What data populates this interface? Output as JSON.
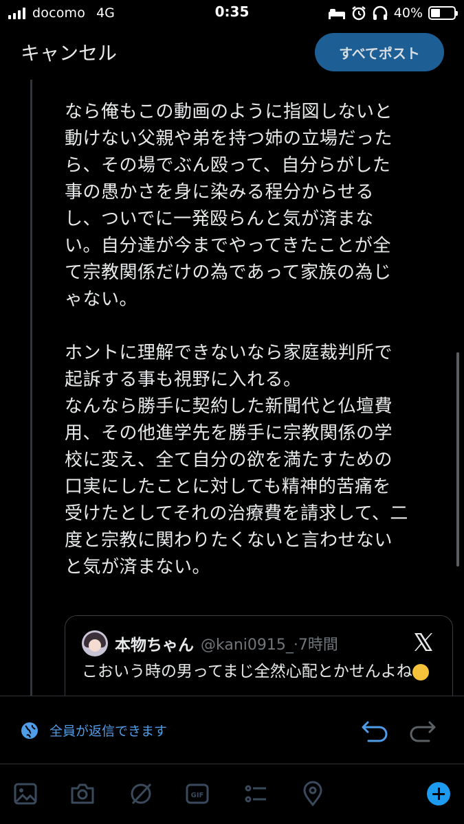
{
  "status": {
    "carrier": "docomo",
    "network": "4G",
    "time": "0:35",
    "battery_percent": "40%",
    "battery_level": 0.4
  },
  "header": {
    "cancel_label": "キャンセル",
    "post_all_label": "すべてポスト"
  },
  "post": {
    "paragraphs": [
      "なら俺もこの動画のように指図しないと動けない父親や弟を持つ姉の立場だったら、その場でぶん殴って、自分らがした事の愚かさを身に染みる程分からせるし、ついでに一発殴らんと気が済まない。自分達が今までやってきたことが全て宗教関係だけの為であって家族の為じゃない。",
      "ホントに理解できないなら家庭裁判所で起訴する事も視野に入れる。\nなんなら勝手に契約した新聞代と仏壇費用、その他進学先を勝手に宗教関係の学校に変え、全て自分の欲を満たすための口実にしたことに対しても精神的苦痛を受けたとしてそれの治療費を請求して、二度と宗教に関わりたくないと言わせないと気が済まない。"
    ]
  },
  "quote": {
    "name": "本物ちゃん",
    "handle": "@kani0915_·7時間",
    "text": "こおいう時の男ってまじ全然心配とかせんよね"
  },
  "reply": {
    "label": "全員が返信できます"
  },
  "colors": {
    "accent": "#1d9bf0",
    "post_button": "#1d5e95",
    "reply_text": "#4f9de8"
  },
  "toolbar": {
    "icons": [
      "image-icon",
      "camera-icon",
      "grok-icon",
      "gif-icon",
      "poll-icon",
      "location-icon",
      "add-post-icon"
    ]
  }
}
